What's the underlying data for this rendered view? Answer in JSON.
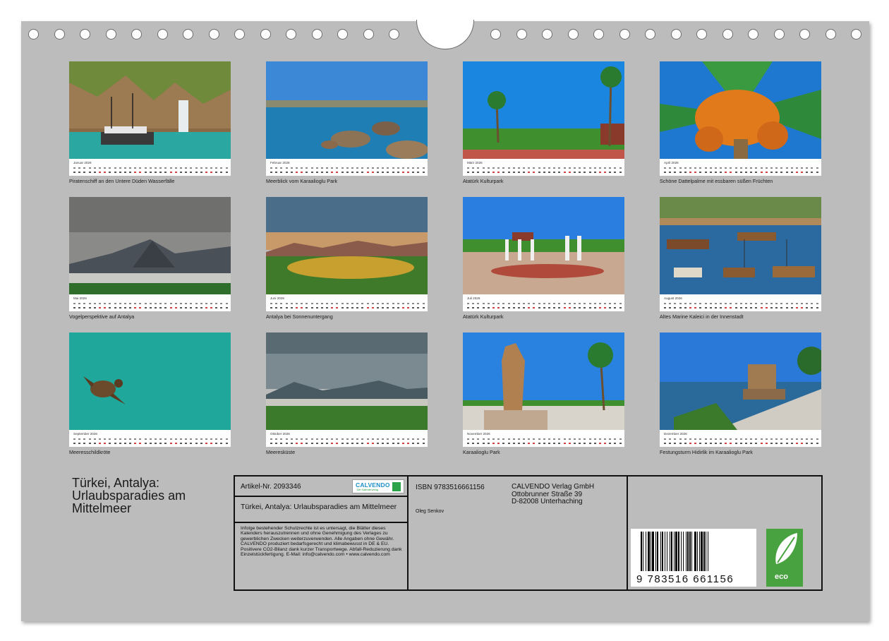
{
  "months": [
    {
      "label": "Januar 2026",
      "caption": "Piratenschiff an den Untere Düden Wasserfälle"
    },
    {
      "label": "Februar 2026",
      "caption": "Meerblick vom Karaalioglu Park"
    },
    {
      "label": "März 2026",
      "caption": "Atatürk Kulturpark"
    },
    {
      "label": "April 2026",
      "caption": "Schöne Dattelpalme mit essbaren süßen Früchten"
    },
    {
      "label": "Mai 2026",
      "caption": "Vogelperspektive auf Antalya"
    },
    {
      "label": "Juni 2026",
      "caption": "Antalya bei Sonnenuntergang"
    },
    {
      "label": "Juli 2026",
      "caption": "Atatürk Kulturpark"
    },
    {
      "label": "August 2026",
      "caption": "Altes Marine Kaleici in der Innenstadt"
    },
    {
      "label": "September 2026",
      "caption": "Meeresschildkröte"
    },
    {
      "label": "Oktober 2026",
      "caption": "Meeresküste"
    },
    {
      "label": "November 2026",
      "caption": "Karaalioglu Park"
    },
    {
      "label": "Dezember 2026",
      "caption": "Festungsturm Hidirlik im Karaalioglu Park"
    }
  ],
  "cover_title": "Türkei, Antalya: Urlaubsparadies am Mittelmeer",
  "info": {
    "artikel": "Artikel-Nr. 2093346",
    "logo": "CALVENDO",
    "logo_sub": "Der Kalenderverlag",
    "title": "Türkei, Antalya: Urlaubsparadies am Mittelmeer",
    "legal": "Infolge bestehender Schutzrechte ist es untersagt, die Blätter dieses Kalenders herauszutrennen und ohne Genehmigung des Verlages zu gewerblichen Zwecken weiterzuverwenden. Alle Angaben ohne Gewähr. CALVENDO produziert bedarfsgerecht und klimabewusst in DE & EU. Positivere CO2-Bilanz dank kurzer Transportwege. Abfall-Reduzierung dank Einzelstückfertigung. E-Mail: info@calvendo.com • www.calvendo.com",
    "isbn": "ISBN 9783516661156",
    "author": "Oleg Senkov",
    "publisher_name": "CALVENDO Verlag GmbH",
    "publisher_street": "Ottobrunner Straße 39",
    "publisher_city": "D-82008 Unterhaching",
    "barcode_number": "9   783516   661156",
    "eco_label": "eco"
  },
  "colors": {
    "sheet": "#bcbcbc",
    "eco": "#47a23f",
    "calvendo": "#1b8fc9",
    "weekend": "#d04040"
  }
}
